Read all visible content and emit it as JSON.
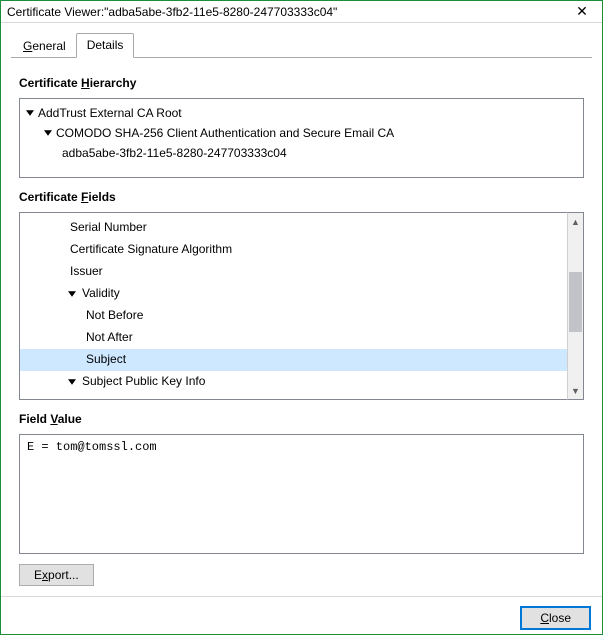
{
  "window": {
    "title": "Certificate Viewer:\"adba5abe-3fb2-11e5-8280-247703333c04\"",
    "close_icon_name": "close-icon"
  },
  "tabs": {
    "general": {
      "label_pre": "",
      "label_ul": "G",
      "label_post": "eneral"
    },
    "details": {
      "label_pre": "",
      "label_ul": "D",
      "label_post": "etails"
    },
    "active": "details"
  },
  "hierarchy": {
    "heading_pre": "Certificate ",
    "heading_ul": "H",
    "heading_post": "ierarchy",
    "rows": [
      {
        "text": "AddTrust External CA Root",
        "indent": 0,
        "expandable": true
      },
      {
        "text": "COMODO SHA-256 Client Authentication and Secure Email CA",
        "indent": 1,
        "expandable": true
      },
      {
        "text": "adba5abe-3fb2-11e5-8280-247703333c04",
        "indent": 2,
        "expandable": false
      }
    ]
  },
  "fields": {
    "heading_pre": "Certificate ",
    "heading_ul": "F",
    "heading_post": "ields",
    "items": [
      {
        "text": "Serial Number",
        "indent": 3,
        "expandable": false,
        "selected": false
      },
      {
        "text": "Certificate Signature Algorithm",
        "indent": 3,
        "expandable": false,
        "selected": false
      },
      {
        "text": "Issuer",
        "indent": 3,
        "expandable": false,
        "selected": false
      },
      {
        "text": "Validity",
        "indent": 3,
        "expandable": true,
        "selected": false
      },
      {
        "text": "Not Before",
        "indent": 4,
        "expandable": false,
        "selected": false
      },
      {
        "text": "Not After",
        "indent": 4,
        "expandable": false,
        "selected": false
      },
      {
        "text": "Subject",
        "indent": 4,
        "expandable": false,
        "selected": true
      },
      {
        "text": "Subject Public Key Info",
        "indent": 3,
        "expandable": true,
        "selected": false
      }
    ]
  },
  "field_value": {
    "heading_pre": "Field ",
    "heading_ul": "V",
    "heading_post": "alue",
    "text": "E = tom@tomssl.com"
  },
  "buttons": {
    "export_pre": "E",
    "export_ul": "x",
    "export_post": "port...",
    "close_pre": "",
    "close_ul": "C",
    "close_post": "lose"
  }
}
